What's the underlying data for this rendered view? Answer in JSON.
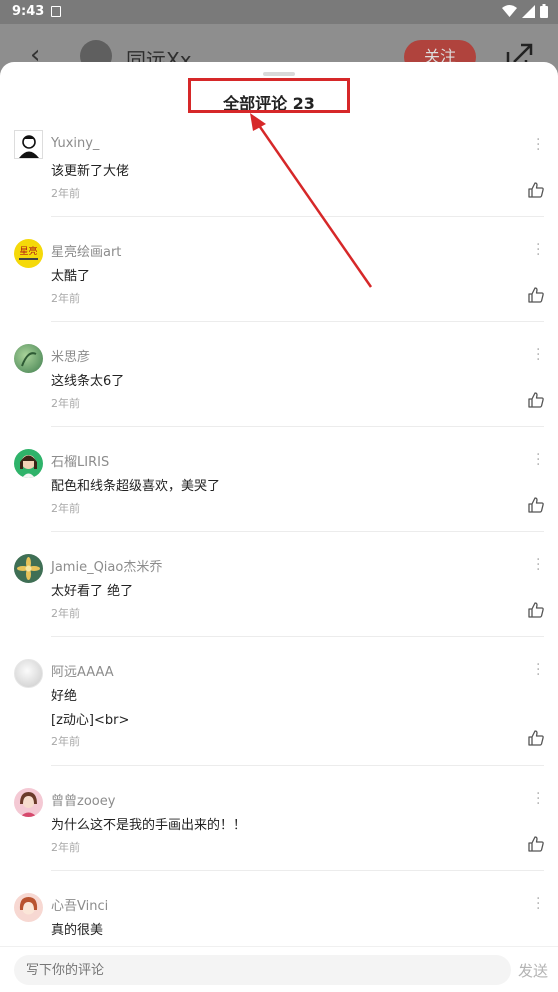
{
  "status_bar": {
    "time": "9:43"
  },
  "header": {
    "author_name": "同远Xx",
    "follow_label": "关注"
  },
  "sheet": {
    "title": "全部评论 23"
  },
  "comments": [
    {
      "user": "Yuxiny_",
      "text": "该更新了大佬",
      "extra": "",
      "time": "2年前"
    },
    {
      "user": "星亮绘画art",
      "text": "太酷了",
      "extra": "",
      "time": "2年前"
    },
    {
      "user": "米思彦",
      "text": "这线条太6了",
      "extra": "",
      "time": "2年前"
    },
    {
      "user": "石榴LIRIS",
      "text": "配色和线条超级喜欢，美哭了",
      "extra": "",
      "time": "2年前"
    },
    {
      "user": "Jamie_Qiao杰米乔",
      "text": "太好看了 绝了",
      "extra": "",
      "time": "2年前"
    },
    {
      "user": "阿远AAAA",
      "text": "好绝",
      "extra": "[z动心]<br>",
      "time": "2年前"
    },
    {
      "user": "曾曾zooey",
      "text": "为什么这不是我的手画出来的！！",
      "extra": "",
      "time": "2年前"
    },
    {
      "user": "心吾Vinci",
      "text": "真的很美",
      "extra": "",
      "time": ""
    }
  ],
  "input": {
    "placeholder": "写下你的评论",
    "send_label": "发送"
  },
  "icons": {
    "back": "back-arrow-icon",
    "share": "share-icon",
    "more": "more-vertical-icon",
    "like": "thumbs-up-icon"
  },
  "colors": {
    "accent": "#d62829",
    "follow": "#b0433d"
  }
}
